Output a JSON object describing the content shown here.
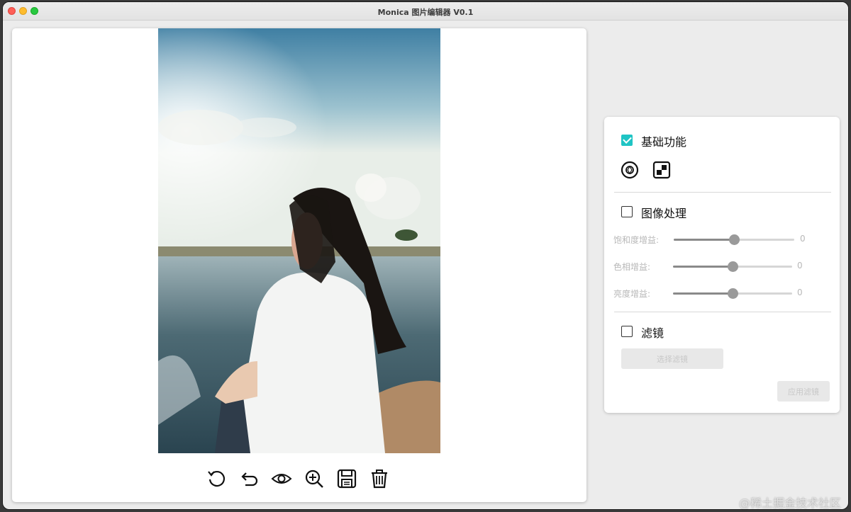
{
  "window": {
    "title": "Monica 图片编辑器 V0.1"
  },
  "toolbar": {
    "tools": [
      {
        "icon": "rotate-icon"
      },
      {
        "icon": "undo-icon"
      },
      {
        "icon": "eye-icon"
      },
      {
        "icon": "zoom-in-icon"
      },
      {
        "icon": "save-icon"
      },
      {
        "icon": "trash-icon"
      }
    ]
  },
  "panel": {
    "basic": {
      "label": "基础功能",
      "checked": true,
      "icons": [
        "aperture-icon",
        "crop-icon"
      ]
    },
    "image_processing": {
      "label": "图像处理",
      "checked": false,
      "sliders": [
        {
          "label": "饱和度增益:",
          "value": "0",
          "level": 0.5
        },
        {
          "label": "色相增益:",
          "value": "0",
          "level": 0.5
        },
        {
          "label": "亮度增益:",
          "value": "0",
          "level": 0.5
        }
      ]
    },
    "filter": {
      "label": "滤镜",
      "checked": false,
      "select_button": "选择滤镜",
      "apply_button": "应用滤镜"
    }
  },
  "watermark": "@稀土掘金技术社区",
  "colors": {
    "accent": "#1fc4c4"
  }
}
